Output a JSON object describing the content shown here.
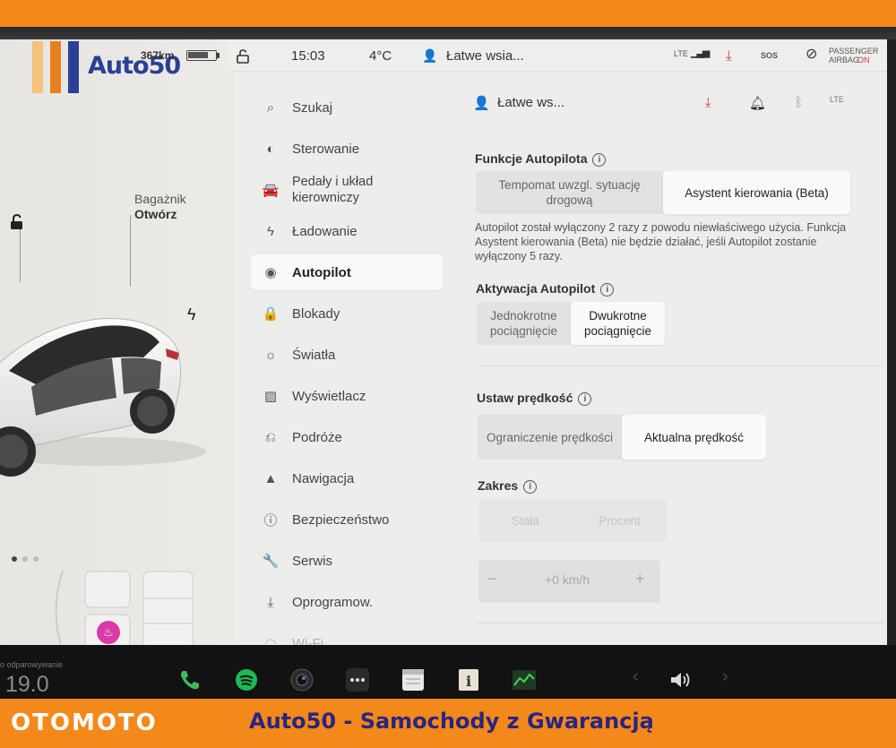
{
  "banners": {
    "brand": "OTOMOTO",
    "tagline": "Auto50 - Samochody z Gwarancją"
  },
  "logo": {
    "text": "Auto50",
    "bar_colors": [
      "#f5c27a",
      "#ea7f1e",
      "#2b3f96"
    ]
  },
  "car_panel": {
    "range": "367km",
    "battery_level": 0.75,
    "trunk_label": "Bagażnik",
    "trunk_action": "Otwórz",
    "dock_temp": "19.0",
    "dock_small_text": "o odparowywanie"
  },
  "status_bar": {
    "time": "15:03",
    "temperature": "4°C",
    "profile": "Łatwe wsia...",
    "lte": "LTE",
    "sos": "SOS",
    "airbag_line1": "PASSENGER",
    "airbag_line2": "AIRBAG",
    "airbag_state": "ON"
  },
  "nav": {
    "items": [
      {
        "label": "Szukaj",
        "icon": "search-icon",
        "glyph": "⌕"
      },
      {
        "label": "Sterowanie",
        "icon": "toggle-icon",
        "glyph": "◐"
      },
      {
        "label": "Pedały i układ kierowniczy",
        "icon": "car-icon",
        "glyph": "🚘"
      },
      {
        "label": "Ładowanie",
        "icon": "bolt-icon",
        "glyph": "ϟ"
      },
      {
        "label": "Autopilot",
        "icon": "steering-wheel-icon",
        "glyph": "◉"
      },
      {
        "label": "Blokady",
        "icon": "lock-icon",
        "glyph": "🔒"
      },
      {
        "label": "Światła",
        "icon": "sun-icon",
        "glyph": "☼"
      },
      {
        "label": "Wyświetlacz",
        "icon": "display-icon",
        "glyph": "▨"
      },
      {
        "label": "Podróże",
        "icon": "route-icon",
        "glyph": "⎌"
      },
      {
        "label": "Nawigacja",
        "icon": "navigation-icon",
        "glyph": "▲"
      },
      {
        "label": "Bezpieczeństwo",
        "icon": "safety-icon",
        "glyph": "ⓘ"
      },
      {
        "label": "Serwis",
        "icon": "wrench-icon",
        "glyph": "🔧"
      },
      {
        "label": "Oprogramow.",
        "icon": "download-icon",
        "glyph": "⤓"
      },
      {
        "label": "Wi-Fi",
        "icon": "wifi-icon",
        "glyph": "◠"
      }
    ],
    "active": "Autopilot"
  },
  "header": {
    "profile": "Łatwe ws..."
  },
  "autopilot": {
    "features_title": "Funkcje Autopilota",
    "features_options": [
      "Tempomat uwzgl. sytuację drogową",
      "Asystent kierowania (Beta)"
    ],
    "features_selected": "Asystent kierowania (Beta)",
    "note": "Autopilot został wyłączony 2 razy z powodu niewłaściwego użycia. Funkcja Asystent kierowania (Beta) nie będzie działać, jeśli Autopilot zostanie wyłączony 5 razy.",
    "activation_title": "Aktywacja Autopilot",
    "activation_options": [
      "Jednokrotne pociągnięcie",
      "Dwukrotne pociągnięcie"
    ],
    "activation_selected": "Dwukrotne pociągnięcie",
    "speed_title": "Ustaw prędkość",
    "speed_options": [
      "Ograniczenie prędkości",
      "Aktualna prędkość"
    ],
    "speed_selected": "Aktualna prędkość",
    "range_title": "Zakres",
    "range_options": [
      "Stała",
      "Procent"
    ],
    "offset_minus": "−",
    "offset_value": "+0 km/h",
    "offset_plus": "+"
  },
  "colors": {
    "banner": "#f3891a",
    "tagline": "#2a2580",
    "accent_pink": "#d93aa7",
    "download_red": "#d9383a"
  }
}
